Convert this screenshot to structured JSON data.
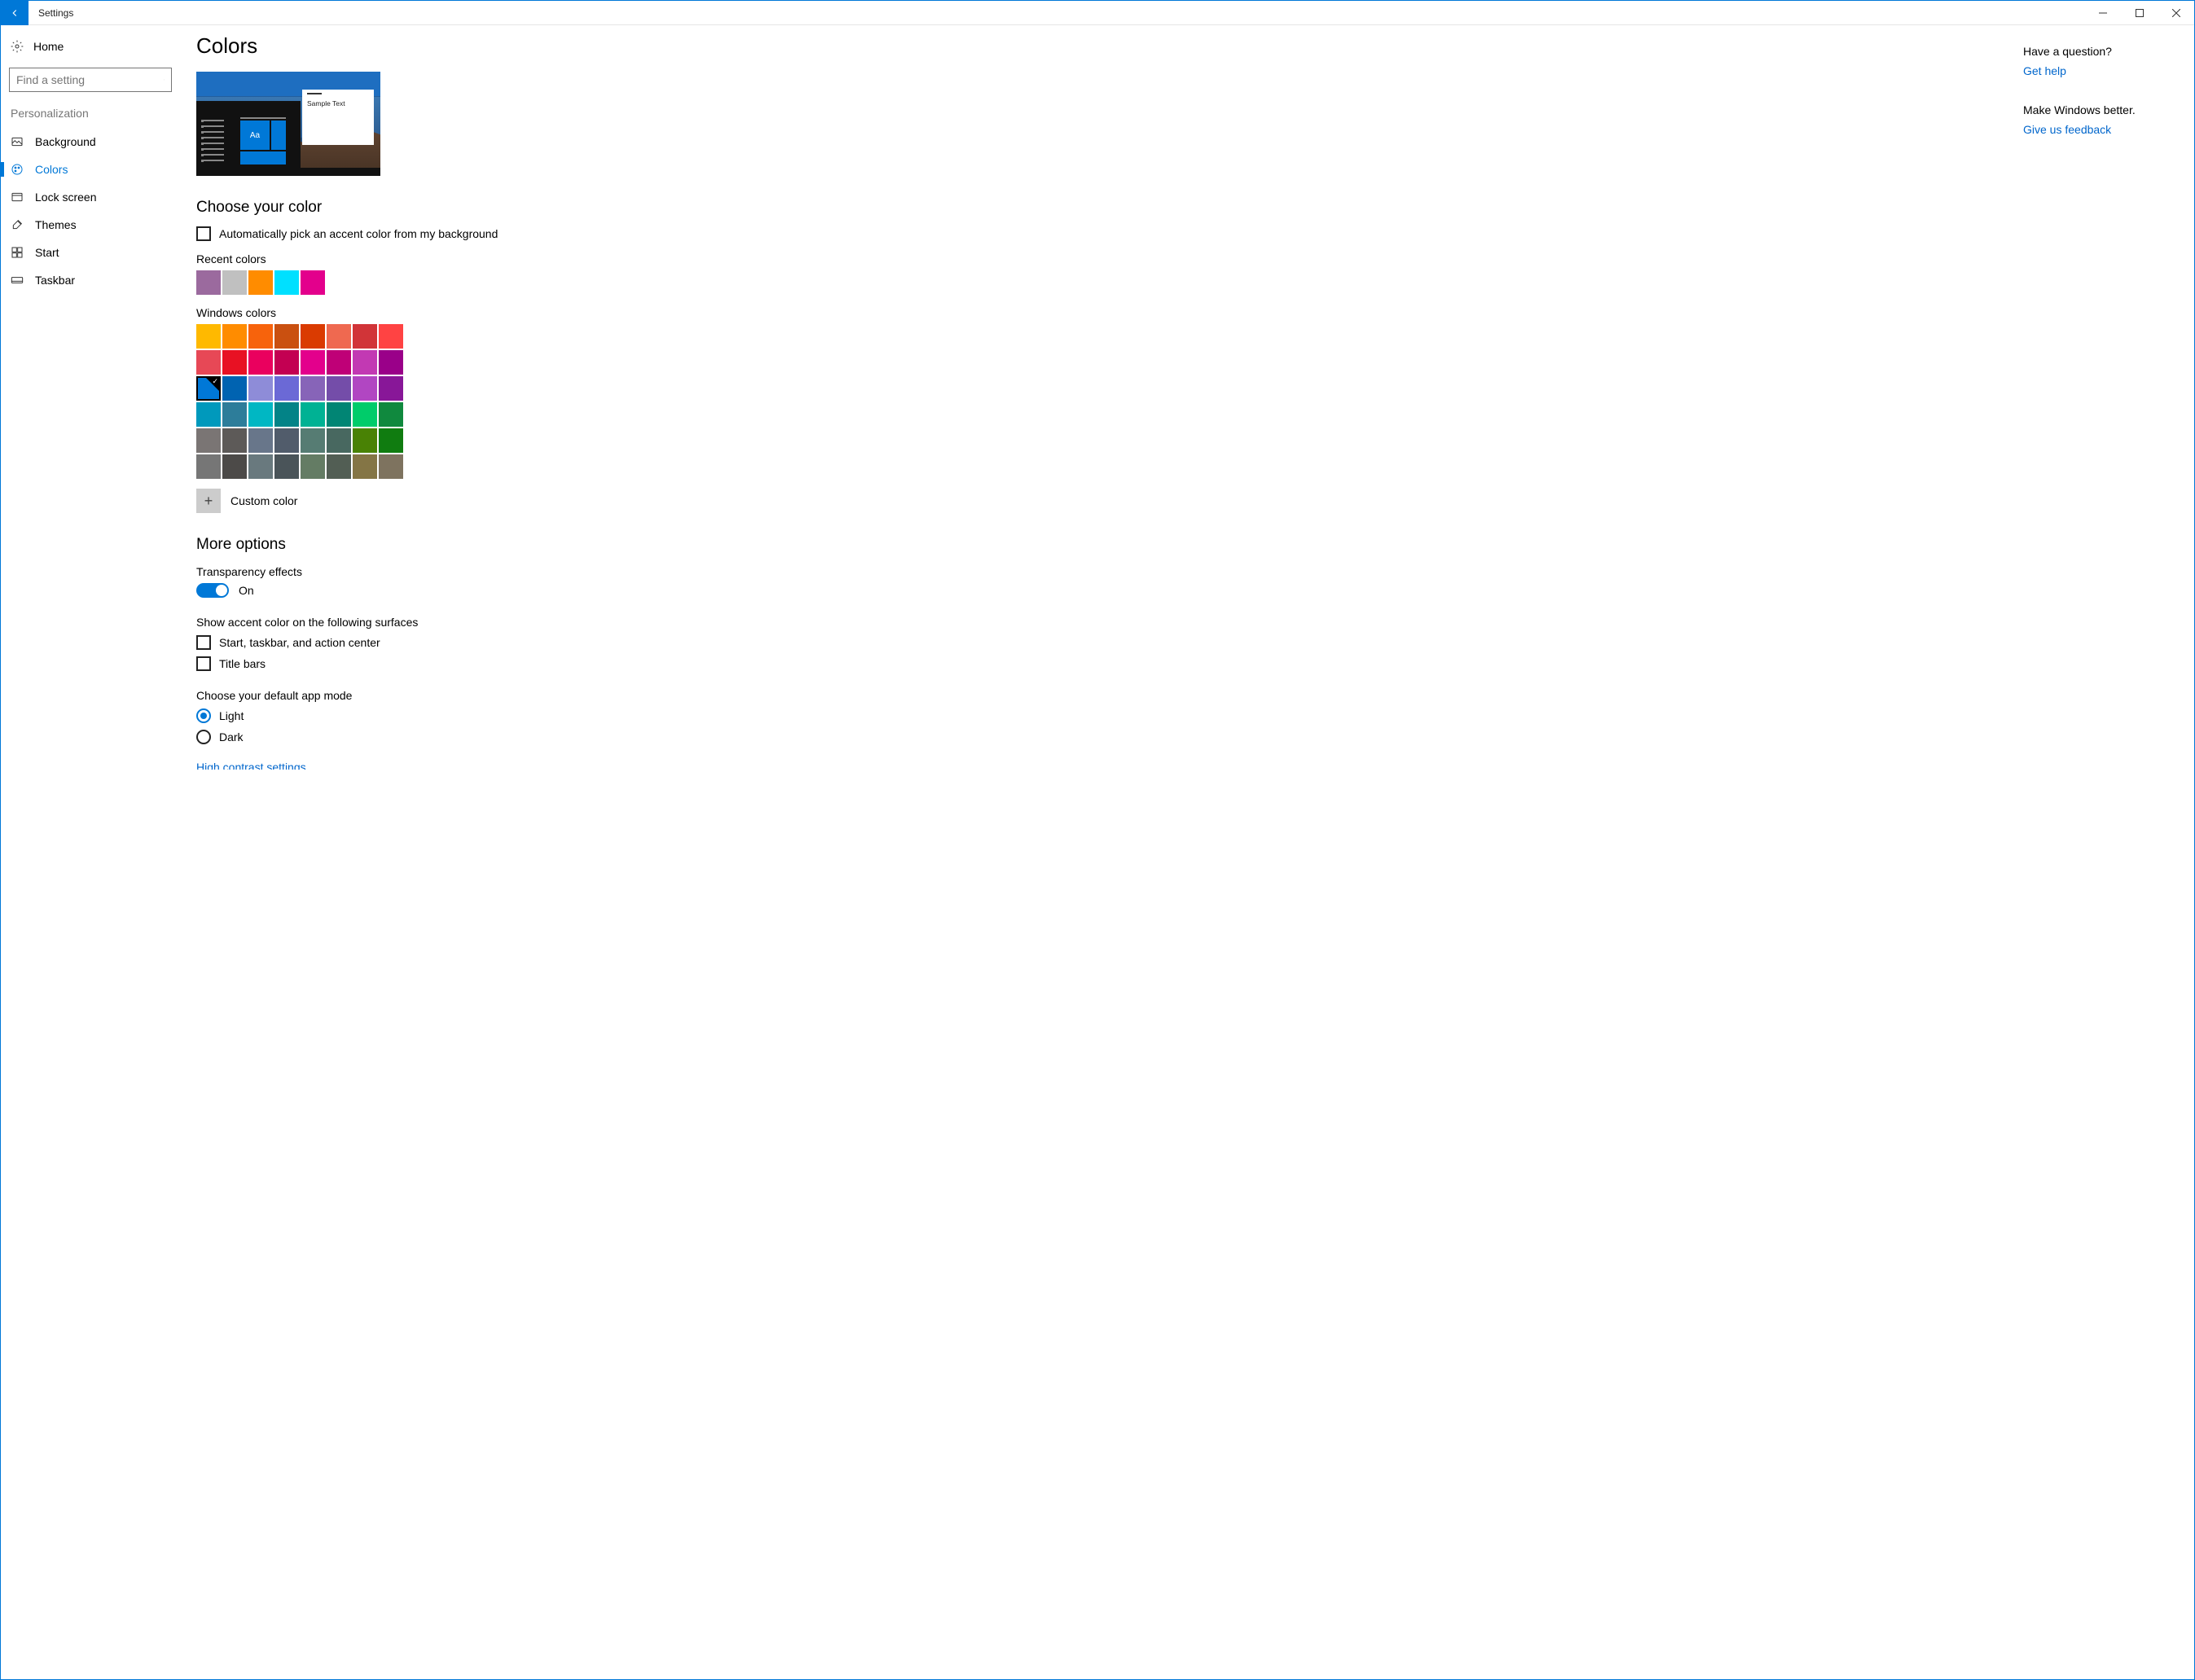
{
  "window": {
    "title": "Settings"
  },
  "sidebar": {
    "home": "Home",
    "search_placeholder": "Find a setting",
    "category": "Personalization",
    "items": [
      {
        "label": "Background"
      },
      {
        "label": "Colors"
      },
      {
        "label": "Lock screen"
      },
      {
        "label": "Themes"
      },
      {
        "label": "Start"
      },
      {
        "label": "Taskbar"
      }
    ]
  },
  "page": {
    "title": "Colors",
    "preview_sample": "Sample Text",
    "preview_aa": "Aa",
    "choose_color_heading": "Choose your color",
    "auto_pick_label": "Automatically pick an accent color from my background",
    "recent_label": "Recent colors",
    "recent_colors": [
      "#9b6a9e",
      "#c0c0c0",
      "#ff8c00",
      "#00e0ff",
      "#e3008c"
    ],
    "windows_colors_label": "Windows colors",
    "windows_colors_selected_index": 16,
    "windows_colors": [
      "#ffb900",
      "#ff8c00",
      "#f7630c",
      "#ca5010",
      "#da3b01",
      "#ef6950",
      "#d13438",
      "#ff4343",
      "#e74856",
      "#e81123",
      "#ea005e",
      "#c30052",
      "#e3008c",
      "#bf0077",
      "#c239b3",
      "#9a0089",
      "#0078d7",
      "#0063b1",
      "#8e8cd8",
      "#6b69d6",
      "#8764b8",
      "#744da9",
      "#b146c2",
      "#881798",
      "#0099bc",
      "#2d7d9a",
      "#00b7c3",
      "#038387",
      "#00b294",
      "#018574",
      "#00cc6a",
      "#10893e",
      "#7a7574",
      "#5d5a58",
      "#68768a",
      "#515c6b",
      "#567c73",
      "#486860",
      "#498205",
      "#107c10",
      "#767676",
      "#4c4a48",
      "#69797e",
      "#4a5459",
      "#647c64",
      "#525e54",
      "#847545",
      "#7e735f"
    ],
    "custom_color_label": "Custom color",
    "more_options_heading": "More options",
    "transparency_label": "Transparency effects",
    "transparency_state": "On",
    "surfaces_label": "Show accent color on the following surfaces",
    "surface_start": "Start, taskbar, and action center",
    "surface_title": "Title bars",
    "default_mode_label": "Choose your default app mode",
    "mode_light": "Light",
    "mode_dark": "Dark",
    "high_contrast_link": "High contrast settings"
  },
  "right": {
    "question": "Have a question?",
    "get_help": "Get help",
    "better": "Make Windows better.",
    "feedback": "Give us feedback"
  }
}
